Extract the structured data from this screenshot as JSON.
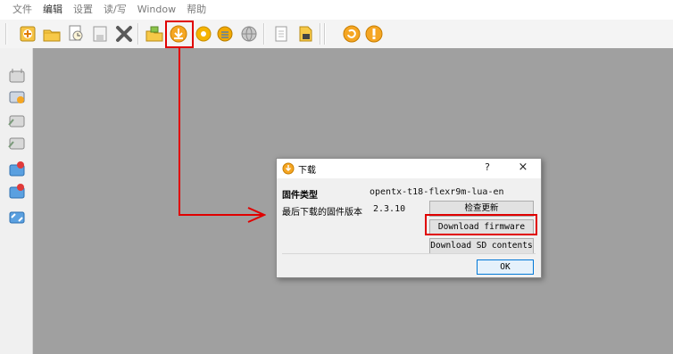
{
  "menubar": {
    "items": [
      "文件",
      "编辑",
      "设置",
      "读/写",
      "Window",
      "帮助"
    ]
  },
  "toolbar": {
    "icons": [
      "new-icon",
      "open-icon",
      "print-preview-icon",
      "save-icon",
      "delete-icon",
      "folder-open-icon",
      "download-icon",
      "settings-gear-icon",
      "radio-settings-icon",
      "globe-icon",
      "document-icon",
      "sd-card-icon",
      "write-icon",
      "info-icon"
    ]
  },
  "left_toolbar": {
    "icons": [
      "radio-icon",
      "radio-copy-icon",
      "radio-read-icon",
      "radio-write-icon",
      "radio-backup-icon",
      "radio-restore-icon",
      "radio-sync-icon"
    ]
  },
  "dialog": {
    "title": "下载",
    "help": "?",
    "close": "×",
    "firmware_type_label": "固件类型",
    "firmware_type_value": "opentx-t18-flexr9m-lua-en",
    "last_version_label": "最后下载的固件版本",
    "last_version_value": "2.3.10",
    "check_update_btn": "检查更新",
    "download_firmware_btn": "Download firmware",
    "download_sd_btn": "Download SD contents",
    "ok_btn": "OK"
  },
  "colors": {
    "mdi_background": "#a0a0a0",
    "annotation_red": "#e00000",
    "focus_blue": "#0078d7"
  }
}
